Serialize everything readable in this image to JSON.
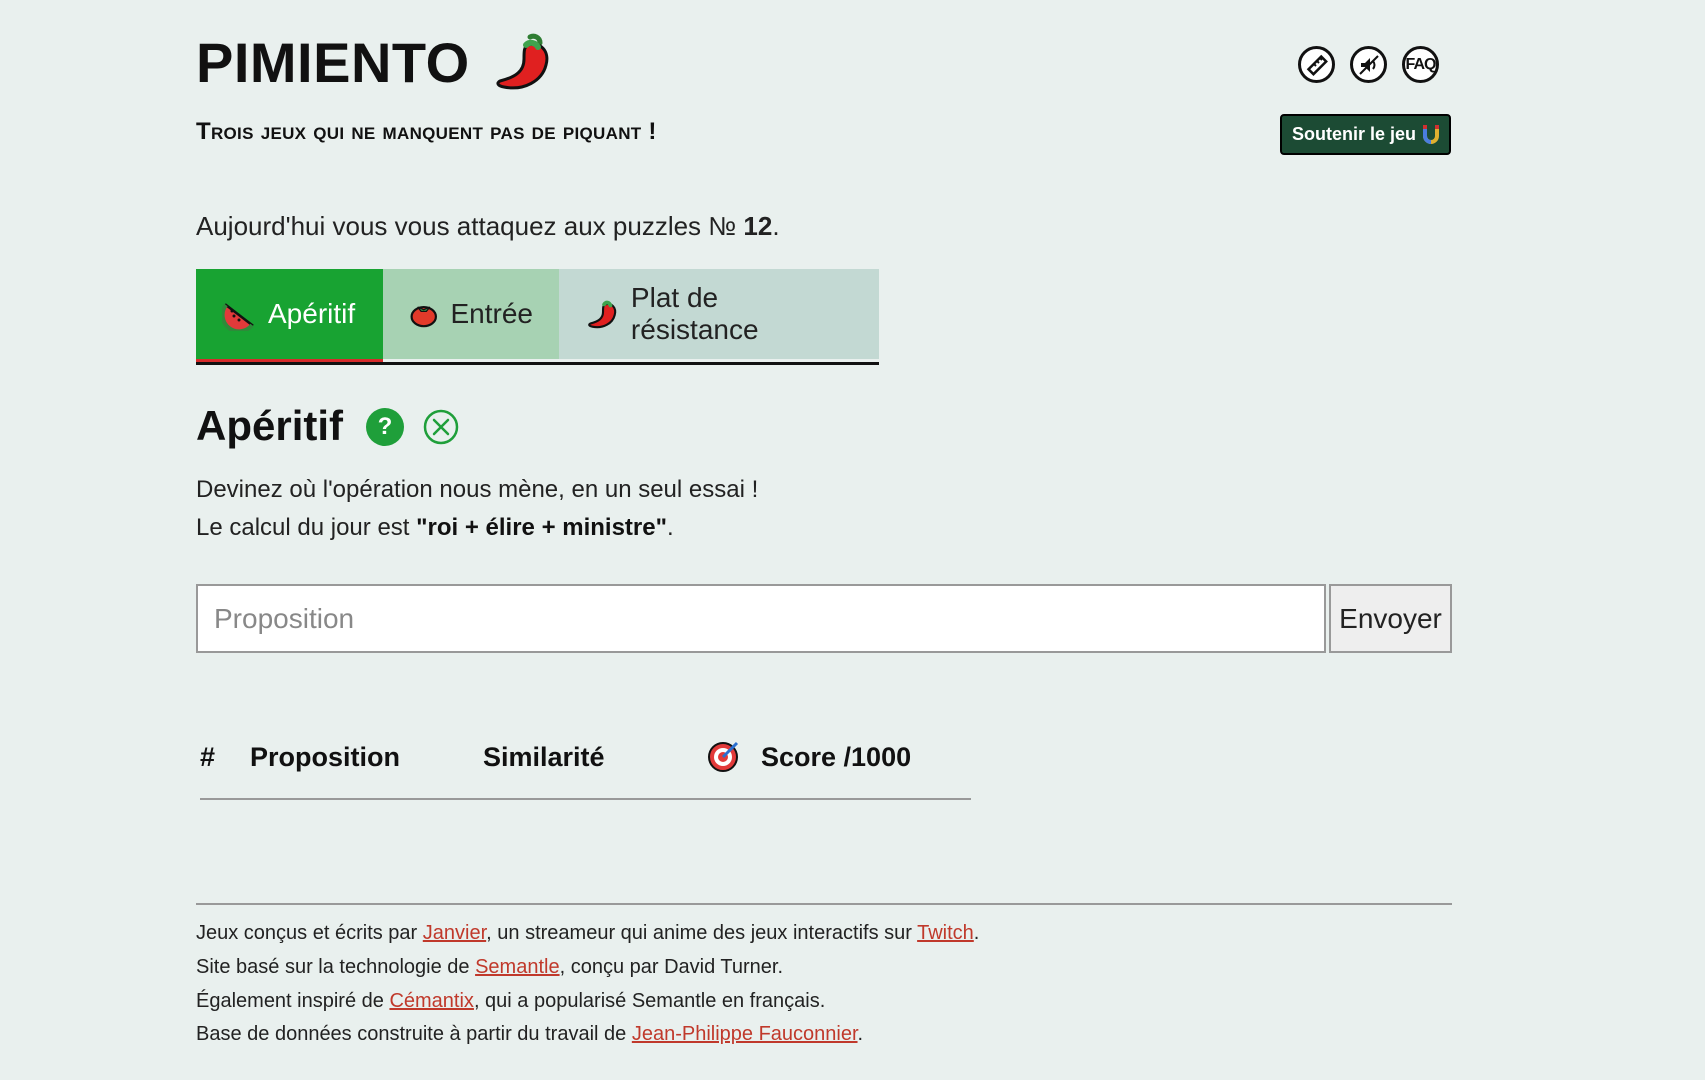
{
  "header": {
    "title": "PIMIENTO",
    "subtitle": "Trois jeux qui ne manquent pas de piquant !",
    "support_label": "Soutenir le jeu",
    "faq_label": "FAQ"
  },
  "today": {
    "prefix": "Aujourd'hui vous vous attaquez aux puzzles № ",
    "number": "12",
    "suffix": "."
  },
  "tabs": [
    {
      "label": "Apéritif",
      "icon": "watermelon-icon",
      "active": true
    },
    {
      "label": "Entrée",
      "icon": "tomato-icon",
      "active": false
    },
    {
      "label": "Plat de résistance",
      "icon": "chili-pepper-icon",
      "active": false
    }
  ],
  "section": {
    "title": "Apéritif",
    "help_symbol": "?",
    "desc1": "Devinez où l'opération nous mène, en un seul essai !",
    "desc2_prefix": "Le calcul du jour est ",
    "desc2_bold": "\"roi + élire + ministre\"",
    "desc2_suffix": "."
  },
  "form": {
    "placeholder": "Proposition",
    "value": "",
    "submit_label": "Envoyer"
  },
  "table": {
    "headers": [
      "#",
      "Proposition",
      "Similarité",
      "Score /1000"
    ],
    "rows": []
  },
  "footer": {
    "line1": {
      "t1": "Jeux conçus et écrits par ",
      "l1": "Janvier",
      "t2": ", un streameur qui anime des jeux interactifs sur ",
      "l2": "Twitch",
      "t3": "."
    },
    "line2": {
      "t1": "Site basé sur la technologie de ",
      "l1": "Semantle",
      "t2": ", conçu par David Turner."
    },
    "line3": {
      "t1": "Également inspiré de ",
      "l1": "Cémantix",
      "t2": ", qui a popularisé Semantle en français."
    },
    "line4": {
      "t1": "Base de données construite à partir du travail de ",
      "l1": "Jean-Philippe Fauconnier",
      "t2": "."
    }
  },
  "colors": {
    "background": "#e9f0ee",
    "active_tab": "#18a332",
    "support_button": "#1c4b34",
    "link": "#c0392b"
  }
}
